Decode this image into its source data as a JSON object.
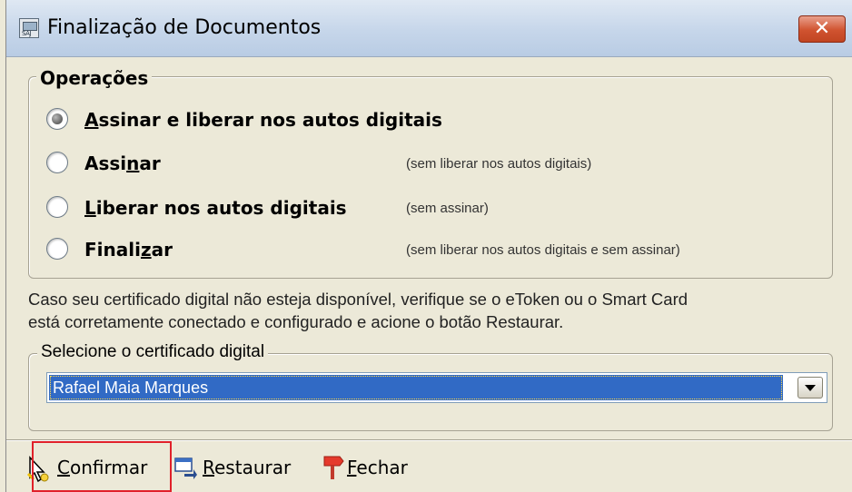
{
  "window": {
    "title": "Finalização de Documentos",
    "app_icon_label": "SAJ",
    "close_label": "✕"
  },
  "operations": {
    "legend": "Operações",
    "options": [
      {
        "prefix": "",
        "accel": "A",
        "suffix": "ssinar e liberar nos autos digitais",
        "hint": "",
        "checked": true
      },
      {
        "prefix": "Assi",
        "accel": "n",
        "suffix": "ar",
        "hint": "(sem liberar nos autos digitais)",
        "checked": false
      },
      {
        "prefix": "",
        "accel": "L",
        "suffix": "iberar nos autos digitais",
        "hint": "(sem assinar)",
        "checked": false
      },
      {
        "prefix": "Finali",
        "accel": "z",
        "suffix": "ar",
        "hint": "(sem liberar nos autos digitais e sem assinar)",
        "checked": false
      }
    ]
  },
  "info": {
    "line1": "Caso seu certificado digital não esteja disponível, verifique se o eToken ou o Smart Card",
    "line2": "está corretamente conectado e configurado e acione o botão Restaurar."
  },
  "certificate": {
    "legend": "Selecione o certificado digital",
    "selected": "Rafael Maia Marques"
  },
  "toolbar": {
    "confirm": {
      "accel": "C",
      "rest": "onfirmar"
    },
    "restore": {
      "accel": "R",
      "rest": "estaurar"
    },
    "close": {
      "accel": "F",
      "rest": "echar"
    }
  },
  "colors": {
    "highlight": "#e0202a",
    "selection": "#316ac5"
  }
}
